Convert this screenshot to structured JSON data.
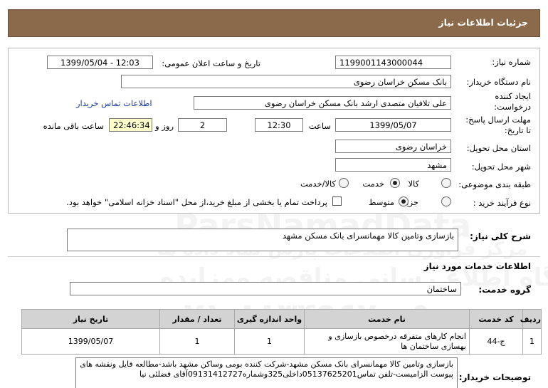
{
  "header": {
    "title": "جزئیات اطلاعات نیاز"
  },
  "info": {
    "need_number_label": "شماره نیاز:",
    "need_number": "1199001143000044",
    "announce_label": "تاریخ و ساعت اعلان عمومی:",
    "announce_value": "1399/05/04 - 12:03",
    "buyer_org_label": "نام دستگاه خریدار:",
    "buyer_org": "بانک مسکن خراسان رضوی",
    "requester_label_1": "ایجاد کننده",
    "requester_label_2": "درخواست:",
    "requester": "علی  تلافیان  متصدی ارشد بانک مسکن خراسان رضوی",
    "contact_link": "اطلاعات تماس خریدار",
    "deadline_label_1": "مهلت ارسال پاسخ:",
    "deadline_label_2": "تا تاریخ:",
    "deadline_date": "1399/05/07",
    "time_label": "ساعت",
    "deadline_time": "12:30",
    "days_value": "2",
    "days_label": "روز و",
    "remaining_time": "22:46:34",
    "remaining_label": "ساعت باقی مانده",
    "province_label": "استان محل تحویل:",
    "province": "خراسان رضوی",
    "city_label": "شهر محل تحویل:",
    "city": "مشهد",
    "category_label": "طبقه بندی موضوعی:",
    "category_options": [
      "کالا",
      "خدمت",
      "کالا/خدمت"
    ],
    "category_selected": "خدمت",
    "purchase_type_label": "نوع فرآیند خرید :",
    "purchase_options": [
      "جزیی",
      "متوسط"
    ],
    "purchase_selected": "متوسط",
    "payment_note": "پرداخت تمام یا بخشی از مبلغ خرید،از محل \"اسناد خزانه اسلامی\" خواهد بود."
  },
  "summary": {
    "label": "شرح کلی نیاز:",
    "text": "بازسازی وتامین کالا مهمانسرای بانک مسکن مشهد"
  },
  "services": {
    "section_title": "اطلاعات خدمات مورد نیاز",
    "group_label": "گروه خدمت:",
    "group_value": "ساختمان",
    "columns": [
      "ردیف",
      "کد خدمت",
      "نام خدمت",
      "واحد اندازه گیری",
      "تعداد / مقدار",
      "تاریخ نیاز"
    ],
    "rows": [
      {
        "row": "1",
        "code": "ج-44",
        "name": "انجام کارهای متفرقه درخصوص بازسازی و بهسازی ساختمان ها",
        "unit": "1",
        "qty": "1",
        "date": "1399/05/07"
      }
    ]
  },
  "buyer_notes": {
    "label": "توضیحات خریدار:",
    "text": "بازسازی وتامین کالا مهمانسرای بانک مسکن مشهد-شرکت کننده بومی وساکن مشهد باشد-مطالعه فایل ونقشه های پیوست الزامیست-تلفن تماس05137625201داخلی325وشماره09131412727آقای فضلئی نیا"
  },
  "watermark": {
    "line1": "ParsNamadData",
    "line2": "مرکز فراوری اطلاعات پارس نماد داده ها",
    "line3": "پایگاه اطلاع رسانی مناقصه ومزایده",
    "line4": "۰۲۱-۸۸۳۴۹۶۷۰-۵"
  },
  "colors": {
    "title_bar": "#8a6a4a",
    "remaining_field": "#ffffcc",
    "table_header": "#d3d3d3",
    "link": "#1a3ea8"
  }
}
